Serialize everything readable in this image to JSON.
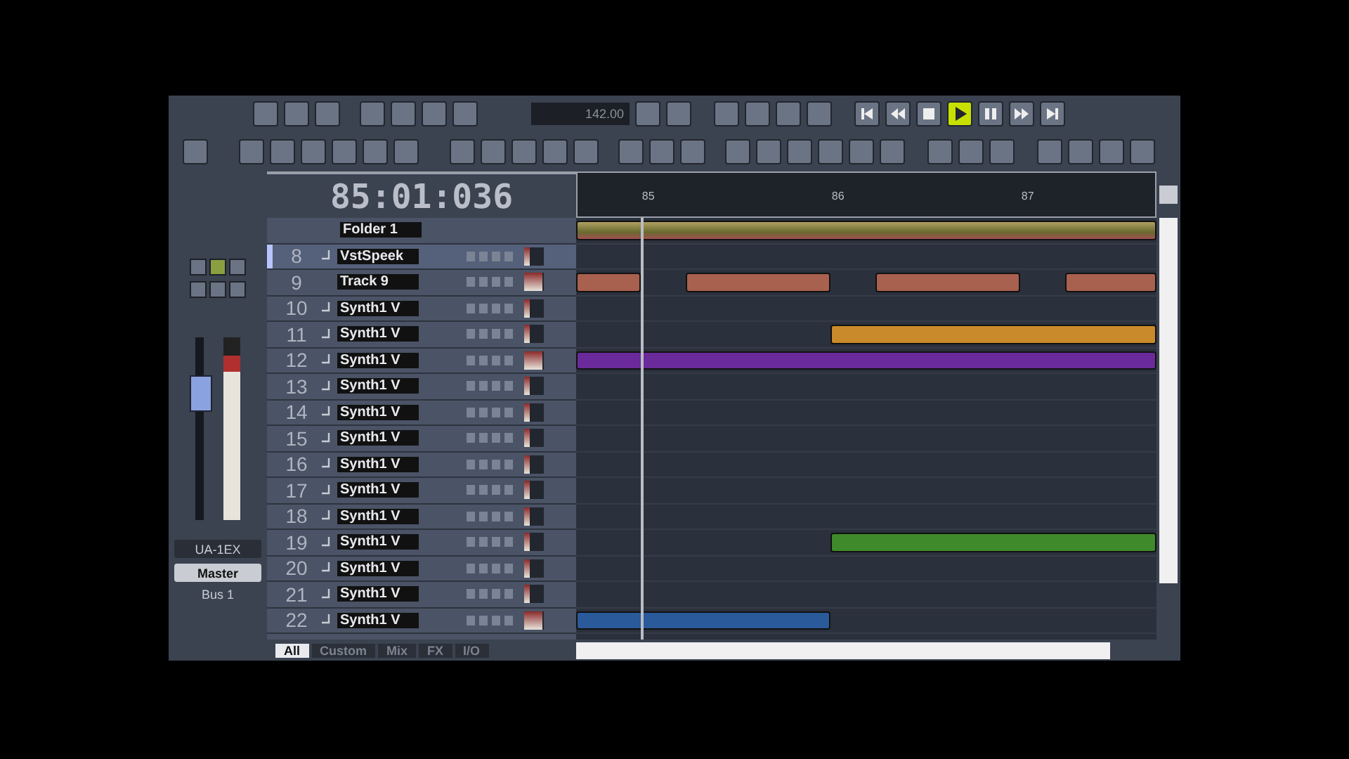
{
  "toolbar": {
    "tempo": "142.00"
  },
  "transport": [
    {
      "kind": "go-start",
      "active": false
    },
    {
      "kind": "rewind",
      "active": false
    },
    {
      "kind": "stop",
      "active": false
    },
    {
      "kind": "play",
      "active": true
    },
    {
      "kind": "pause",
      "active": false
    },
    {
      "kind": "forward",
      "active": false
    },
    {
      "kind": "go-end",
      "active": false
    }
  ],
  "time_display": "85:01:036",
  "ruler": {
    "marks": [
      "85",
      "86",
      "87"
    ]
  },
  "left_strip": {
    "fader": {
      "level": 0.75
    },
    "meter": {
      "level": 0.9
    },
    "input": "UA-1EX",
    "output": "Master",
    "bus": "Bus 1"
  },
  "folder": {
    "name": "Folder 1"
  },
  "tracks": [
    {
      "number": "8",
      "name": "VstSpeek",
      "kind": "instrument",
      "selected": true,
      "level": 0.3
    },
    {
      "number": "9",
      "name": "Track 9",
      "kind": "audio",
      "selected": false,
      "level": 0.9,
      "clips": [
        {
          "kind": "part",
          "color": "#a8604f"
        },
        {
          "kind": "part",
          "color": "#a8604f"
        },
        {
          "kind": "part",
          "color": "#a8604f"
        },
        {
          "kind": "part",
          "color": "#a8604f"
        }
      ]
    },
    {
      "number": "10",
      "name": "Synth1 V",
      "kind": "instrument",
      "selected": false,
      "level": 0.3
    },
    {
      "number": "11",
      "name": "Synth1 V",
      "kind": "instrument",
      "selected": false,
      "level": 0.3,
      "clips": [
        {
          "kind": "tail",
          "color": "#c88a2a"
        }
      ]
    },
    {
      "number": "12",
      "name": "Synth1 V",
      "kind": "instrument",
      "selected": false,
      "level": 0.9,
      "clips": [
        {
          "kind": "whole",
          "color": "#6a2a9a"
        }
      ]
    },
    {
      "number": "13",
      "name": "Synth1 V",
      "kind": "instrument",
      "selected": false,
      "level": 0.3
    },
    {
      "number": "14",
      "name": "Synth1 V",
      "kind": "instrument",
      "selected": false,
      "level": 0.3
    },
    {
      "number": "15",
      "name": "Synth1 V",
      "kind": "instrument",
      "selected": false,
      "level": 0.3
    },
    {
      "number": "16",
      "name": "Synth1 V",
      "kind": "instrument",
      "selected": false,
      "level": 0.3
    },
    {
      "number": "17",
      "name": "Synth1 V",
      "kind": "instrument",
      "selected": false,
      "level": 0.3
    },
    {
      "number": "18",
      "name": "Synth1 V",
      "kind": "instrument",
      "selected": false,
      "level": 0.3
    },
    {
      "number": "19",
      "name": "Synth1 V",
      "kind": "instrument",
      "selected": false,
      "level": 0.3,
      "clips": [
        {
          "kind": "tail",
          "color": "#3f8a2a"
        }
      ]
    },
    {
      "number": "20",
      "name": "Synth1 V",
      "kind": "instrument",
      "selected": false,
      "level": 0.3
    },
    {
      "number": "21",
      "name": "Synth1 V",
      "kind": "instrument",
      "selected": false,
      "level": 0.3
    },
    {
      "number": "22",
      "name": "Synth1 V",
      "kind": "instrument",
      "selected": false,
      "level": 0.9,
      "clips": [
        {
          "kind": "head",
          "color": "#2a5a9a"
        }
      ]
    }
  ],
  "tabs": [
    {
      "label": "All",
      "selected": true
    },
    {
      "label": "Custom",
      "selected": false
    },
    {
      "label": "Mix",
      "selected": false
    },
    {
      "label": "FX",
      "selected": false
    },
    {
      "label": "I/O",
      "selected": false
    }
  ]
}
